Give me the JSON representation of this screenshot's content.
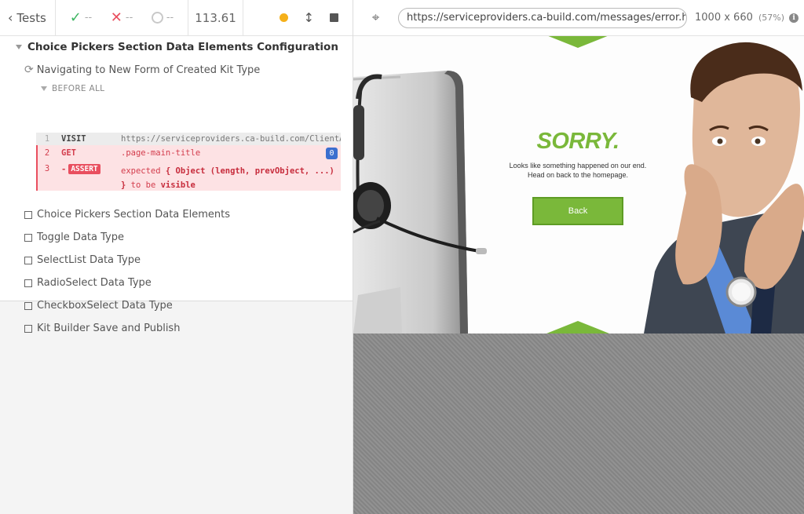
{
  "toolbar": {
    "tests_label": "Tests",
    "passed": "--",
    "failed": "--",
    "pending": "--",
    "duration": "113.61"
  },
  "suite": {
    "title": "Choice Pickers Section Data Elements Configuration",
    "running_test": "Navigating to New Form of Created Kit Type",
    "hook_label": "BEFORE ALL",
    "commands": [
      {
        "num": "1",
        "name": "VISIT",
        "message": "https://serviceproviders.ca-build.com/ClientAdm…"
      },
      {
        "num": "2",
        "name": "GET",
        "message": ".page-main-title",
        "badge": "0"
      },
      {
        "num": "3",
        "prefix": "-",
        "name": "ASSERT",
        "message_parts": [
          "expected",
          "{ Object (length, prevObject, ...) }",
          "to be",
          "visible"
        ]
      }
    ],
    "pending_tests": [
      "Choice Pickers Section Data Elements",
      "Toggle Data Type",
      "SelectList Data Type",
      "RadioSelect Data Type",
      "CheckboxSelect Data Type",
      "Kit Builder Save and Publish"
    ]
  },
  "aut": {
    "url": "https://serviceproviders.ca-build.com/messages/error.html",
    "viewport": "1000 x 660",
    "scale": "(57%)"
  },
  "error_page": {
    "heading": "SORRY.",
    "line1": "Looks like something happened on our end.",
    "line2": "Head on back to the homepage.",
    "button": "Back",
    "accent_color": "#7ab83a"
  }
}
